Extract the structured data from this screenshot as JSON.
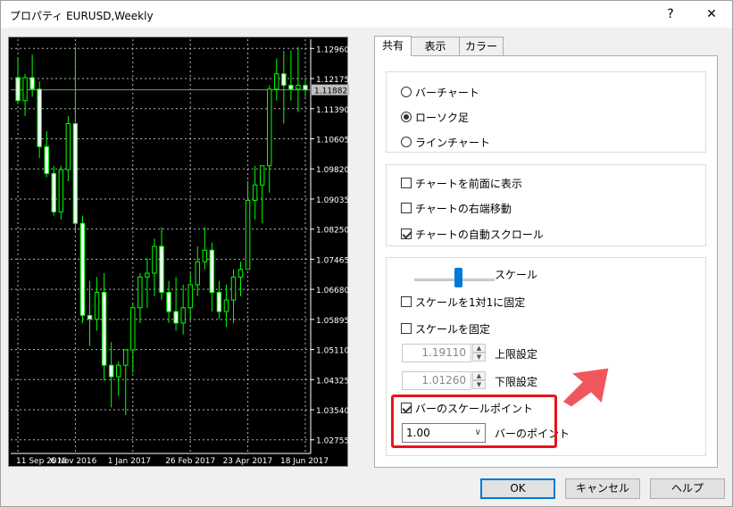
{
  "window": {
    "title": "プロパティ EURUSD,Weekly",
    "help_glyph": "?",
    "close_glyph": "✕"
  },
  "chart": {
    "price_labels": [
      "1.12960",
      "1.12175",
      "1.11390",
      "1.10605",
      "1.09820",
      "1.09035",
      "1.08250",
      "1.07465",
      "1.06680",
      "1.05895",
      "1.05110",
      "1.04325",
      "1.03540",
      "1.02755"
    ],
    "current_price": "1.11882",
    "date_labels": [
      "11 Sep 2016",
      "6 Nov 2016",
      "1 Jan 2017",
      "26 Feb 2017",
      "23 Apr 2017",
      "18 Jun 2017"
    ],
    "colors": {
      "background": "#000000",
      "candle": "#00ff00",
      "bull_fill": "#000000",
      "bear_fill": "#ffffff",
      "grid": "#ffffff",
      "text": "#ffffff"
    }
  },
  "chart_data": {
    "type": "candlestick",
    "ylim": [
      1.024,
      1.132
    ],
    "x": [
      "2016-09-11",
      "2016-09-18",
      "2016-09-25",
      "2016-10-02",
      "2016-10-09",
      "2016-10-16",
      "2016-10-23",
      "2016-10-30",
      "2016-11-06",
      "2016-11-13",
      "2016-11-20",
      "2016-11-27",
      "2016-12-04",
      "2016-12-11",
      "2016-12-18",
      "2016-12-25",
      "2017-01-01",
      "2017-01-08",
      "2017-01-15",
      "2017-01-22",
      "2017-01-29",
      "2017-02-05",
      "2017-02-12",
      "2017-02-19",
      "2017-02-26",
      "2017-03-05",
      "2017-03-12",
      "2017-03-19",
      "2017-03-26",
      "2017-04-02",
      "2017-04-09",
      "2017-04-16",
      "2017-04-23",
      "2017-04-30",
      "2017-05-07",
      "2017-05-14",
      "2017-05-21",
      "2017-05-28",
      "2017-06-04",
      "2017-06-11",
      "2017-06-18"
    ],
    "candles": [
      {
        "o": 1.122,
        "h": 1.127,
        "l": 1.115,
        "c": 1.116
      },
      {
        "o": 1.116,
        "h": 1.123,
        "l": 1.112,
        "c": 1.122
      },
      {
        "o": 1.122,
        "h": 1.128,
        "l": 1.117,
        "c": 1.119
      },
      {
        "o": 1.119,
        "h": 1.121,
        "l": 1.101,
        "c": 1.104
      },
      {
        "o": 1.104,
        "h": 1.108,
        "l": 1.096,
        "c": 1.097
      },
      {
        "o": 1.097,
        "h": 1.099,
        "l": 1.086,
        "c": 1.087
      },
      {
        "o": 1.087,
        "h": 1.099,
        "l": 1.085,
        "c": 1.098
      },
      {
        "o": 1.098,
        "h": 1.112,
        "l": 1.095,
        "c": 1.11
      },
      {
        "o": 1.11,
        "h": 1.13,
        "l": 1.082,
        "c": 1.084
      },
      {
        "o": 1.084,
        "h": 1.086,
        "l": 1.058,
        "c": 1.06
      },
      {
        "o": 1.06,
        "h": 1.069,
        "l": 1.052,
        "c": 1.059
      },
      {
        "o": 1.059,
        "h": 1.07,
        "l": 1.056,
        "c": 1.066
      },
      {
        "o": 1.066,
        "h": 1.071,
        "l": 1.043,
        "c": 1.047
      },
      {
        "o": 1.047,
        "h": 1.053,
        "l": 1.036,
        "c": 1.044
      },
      {
        "o": 1.044,
        "h": 1.048,
        "l": 1.039,
        "c": 1.047
      },
      {
        "o": 1.047,
        "h": 1.051,
        "l": 1.034,
        "c": 1.051
      },
      {
        "o": 1.051,
        "h": 1.063,
        "l": 1.045,
        "c": 1.062
      },
      {
        "o": 1.062,
        "h": 1.071,
        "l": 1.058,
        "c": 1.07
      },
      {
        "o": 1.07,
        "h": 1.075,
        "l": 1.062,
        "c": 1.071
      },
      {
        "o": 1.071,
        "h": 1.08,
        "l": 1.065,
        "c": 1.078
      },
      {
        "o": 1.078,
        "h": 1.083,
        "l": 1.064,
        "c": 1.066
      },
      {
        "o": 1.066,
        "h": 1.069,
        "l": 1.058,
        "c": 1.061
      },
      {
        "o": 1.061,
        "h": 1.07,
        "l": 1.056,
        "c": 1.058
      },
      {
        "o": 1.058,
        "h": 1.068,
        "l": 1.055,
        "c": 1.062
      },
      {
        "o": 1.062,
        "h": 1.071,
        "l": 1.059,
        "c": 1.068
      },
      {
        "o": 1.068,
        "h": 1.078,
        "l": 1.065,
        "c": 1.074
      },
      {
        "o": 1.074,
        "h": 1.083,
        "l": 1.072,
        "c": 1.077
      },
      {
        "o": 1.077,
        "h": 1.079,
        "l": 1.061,
        "c": 1.066
      },
      {
        "o": 1.066,
        "h": 1.069,
        "l": 1.059,
        "c": 1.061
      },
      {
        "o": 1.061,
        "h": 1.068,
        "l": 1.057,
        "c": 1.064
      },
      {
        "o": 1.064,
        "h": 1.072,
        "l": 1.058,
        "c": 1.07
      },
      {
        "o": 1.07,
        "h": 1.074,
        "l": 1.065,
        "c": 1.072
      },
      {
        "o": 1.072,
        "h": 1.095,
        "l": 1.072,
        "c": 1.09
      },
      {
        "o": 1.09,
        "h": 1.099,
        "l": 1.085,
        "c": 1.094
      },
      {
        "o": 1.094,
        "h": 1.099,
        "l": 1.084,
        "c": 1.099
      },
      {
        "o": 1.099,
        "h": 1.12,
        "l": 1.092,
        "c": 1.119
      },
      {
        "o": 1.119,
        "h": 1.127,
        "l": 1.116,
        "c": 1.123
      },
      {
        "o": 1.123,
        "h": 1.129,
        "l": 1.11,
        "c": 1.12
      },
      {
        "o": 1.12,
        "h": 1.129,
        "l": 1.116,
        "c": 1.119
      },
      {
        "o": 1.119,
        "h": 1.13,
        "l": 1.113,
        "c": 1.12
      },
      {
        "o": 1.12,
        "h": 1.122,
        "l": 1.117,
        "c": 1.1188
      }
    ],
    "grid": true
  },
  "tabs": [
    "共有",
    "表示",
    "カラー"
  ],
  "chart_type": {
    "options": [
      "バーチャート",
      "ローソク足",
      "ラインチャート"
    ],
    "selected": 1
  },
  "display_opts": [
    {
      "label": "チャートを前面に表示",
      "checked": false
    },
    {
      "label": "チャートの右端移動",
      "checked": false
    },
    {
      "label": "チャートの自動スクロール",
      "checked": true
    }
  ],
  "scale": {
    "slider_label": "スケール",
    "slider_level": 0.5,
    "fix_1to1": {
      "label": "スケールを1対1に固定",
      "checked": false
    },
    "fix_scale": {
      "label": "スケールを固定",
      "checked": false
    },
    "upper_value": "1.19110",
    "upper_label": "上限設定",
    "lower_value": "1.01260",
    "lower_label": "下限設定",
    "bar_scale_point": {
      "label": "バーのスケールポイント",
      "checked": true
    },
    "bar_point_value": "1.00",
    "bar_point_label": "バーのポイント"
  },
  "buttons": {
    "ok": "OK",
    "cancel": "キャンセル",
    "help": "ヘルプ"
  },
  "annotation": {
    "highlight_color": "#e8131f",
    "arrow_color": "#f0575d"
  }
}
